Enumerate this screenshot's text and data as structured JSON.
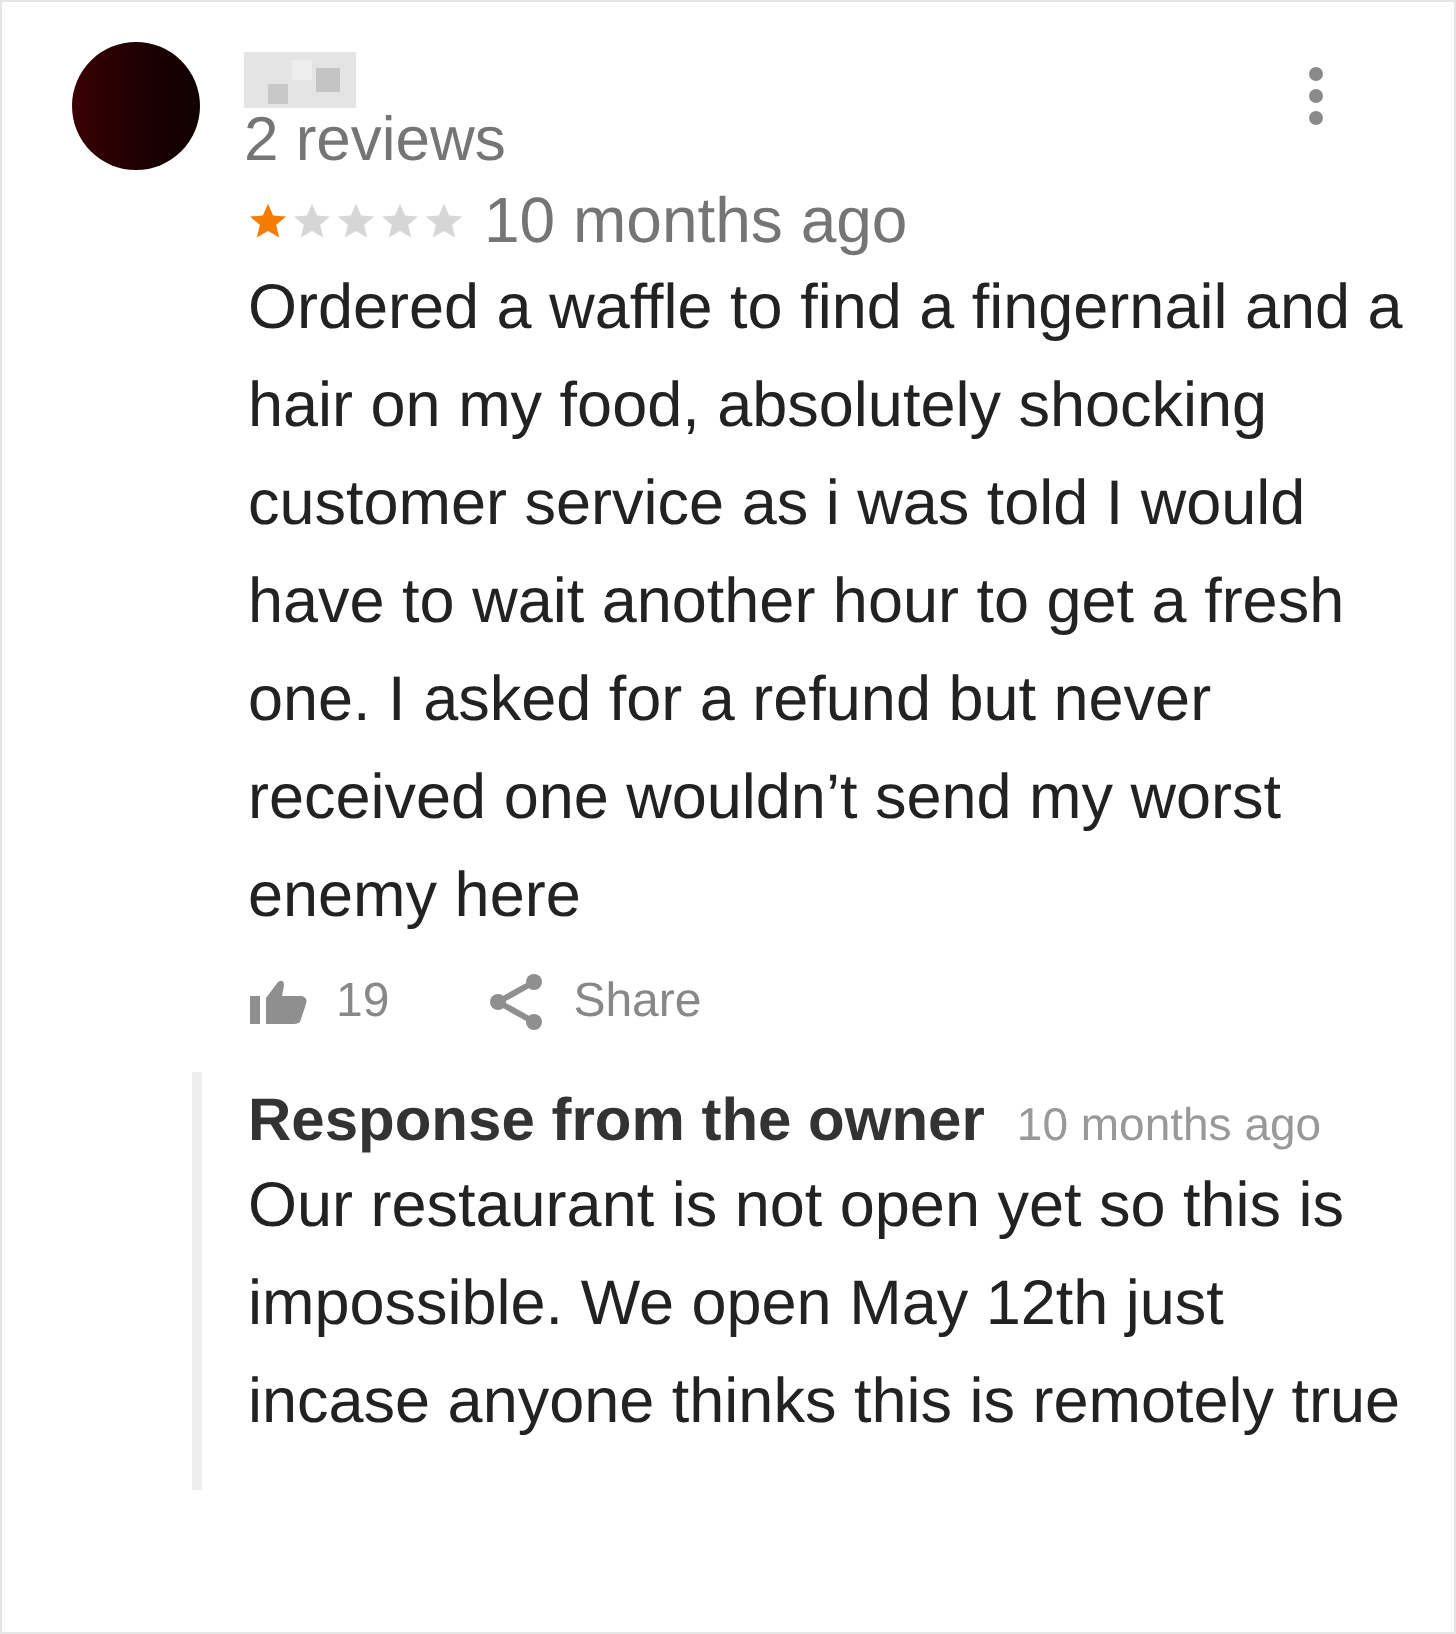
{
  "review": {
    "reviewer_reviews": "2 reviews",
    "stars": 1,
    "time": "10 months ago",
    "text": "Ordered a waffle to find a fingernail and a hair on my food, absolutely shocking customer service as i was told I would have to wait another hour to get a fresh one. I asked for a refund but never received one wouldn’t send my worst enemy here",
    "likes": "19",
    "share_label": "Share"
  },
  "owner_response": {
    "title": "Response from the owner",
    "time": "10 months ago",
    "text": "Our restaurant is not open yet so this is impossible. We open May 12th just incase anyone thinks this is remotely true"
  }
}
